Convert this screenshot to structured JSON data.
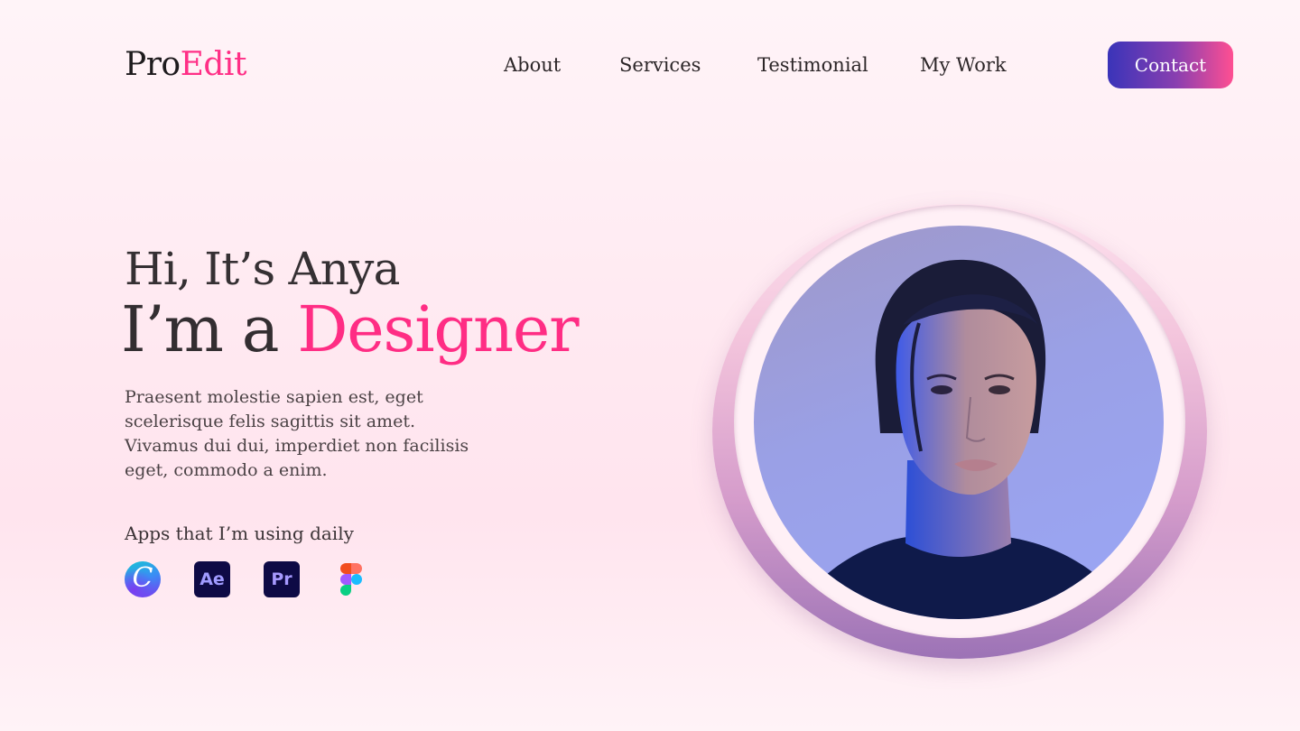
{
  "header": {
    "logo_part1": "Pro",
    "logo_part2": "Edit",
    "nav": [
      "About",
      "Services",
      "Testimonial",
      "My Work"
    ],
    "contact_label": "Contact"
  },
  "hero": {
    "greeting": "Hi, It’s Anya",
    "role_prefix": "I’m a ",
    "role_accent": "Designer",
    "description": "Praesent molestie sapien est, eget scelerisque felis sagittis sit amet. Vivamus dui dui, imperdiet non facilisis eget, commodo a enim.",
    "apps_title": "Apps that I’m using daily",
    "apps": [
      {
        "name": "canva-icon",
        "glyph": "C"
      },
      {
        "name": "after-effects-icon",
        "glyph": "Ae"
      },
      {
        "name": "premiere-pro-icon",
        "glyph": "Pr"
      },
      {
        "name": "figma-icon",
        "glyph": ""
      }
    ]
  },
  "colors": {
    "accent": "#ff2d84",
    "button_gradient_start": "#3a34b9",
    "button_gradient_end": "#ff4f92"
  }
}
